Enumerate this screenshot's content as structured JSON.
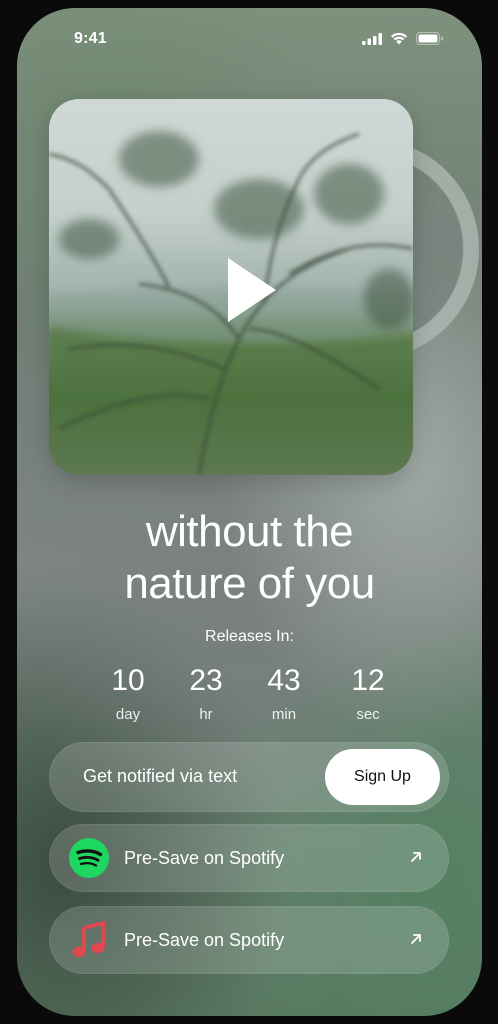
{
  "status_bar": {
    "time": "9:41",
    "icons": [
      "cellular-signal-icon",
      "wifi-icon",
      "battery-icon"
    ]
  },
  "album": {
    "cover_icon": "play-icon"
  },
  "title": {
    "line1": "without the",
    "line2": "nature of you"
  },
  "release": {
    "label": "Releases In:",
    "countdown": [
      {
        "value": "10",
        "unit": "day"
      },
      {
        "value": "23",
        "unit": "hr"
      },
      {
        "value": "43",
        "unit": "min"
      },
      {
        "value": "12",
        "unit": "sec"
      }
    ]
  },
  "notify": {
    "text": "Get notified via text",
    "button_label": "Sign Up"
  },
  "presave_links": [
    {
      "label": "Pre-Save on Spotify",
      "icon": "spotify-icon",
      "icon_color": "#1ED760",
      "arrow_icon": "arrow-up-right-icon"
    },
    {
      "label": "Pre-Save on Spotify",
      "icon": "apple-music-note-icon",
      "icon_color": "#E0484F",
      "arrow_icon": "arrow-up-right-icon"
    }
  ],
  "colors": {
    "spotify_green": "#1ED760",
    "music_red": "#E0484F",
    "button_white": "#FFFFFF"
  }
}
